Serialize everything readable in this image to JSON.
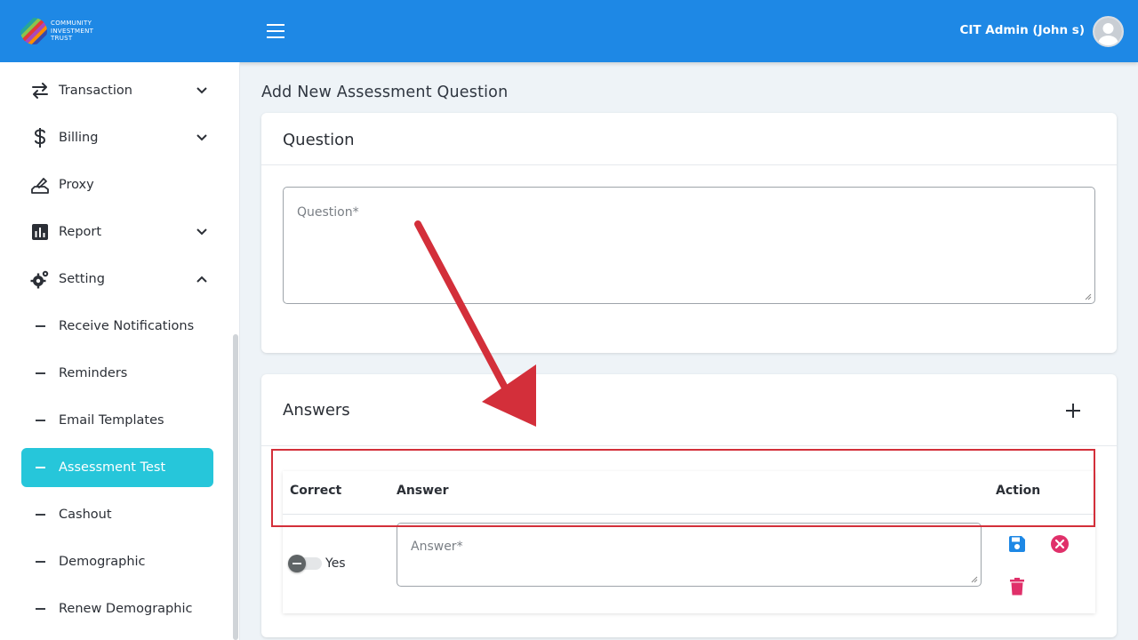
{
  "brand": {
    "logo_lines": [
      "COMMUNITY",
      "INVESTMENT",
      "TRUST"
    ]
  },
  "header": {
    "user_name": "CIT Admin (John s)"
  },
  "sidebar": {
    "items": [
      {
        "label": "Transaction",
        "icon": "transfer-arrows-icon",
        "chevron": "down"
      },
      {
        "label": "Billing",
        "icon": "dollar-icon",
        "chevron": "down"
      },
      {
        "label": "Proxy",
        "icon": "hand-pen-icon"
      },
      {
        "label": "Report",
        "icon": "bar-chart-icon",
        "chevron": "down"
      },
      {
        "label": "Setting",
        "icon": "gears-icon",
        "chevron": "up"
      }
    ],
    "sub_items": [
      {
        "label": "Receive Notifications"
      },
      {
        "label": "Reminders"
      },
      {
        "label": "Email Templates"
      },
      {
        "label": "Assessment Test",
        "active": true
      },
      {
        "label": "Cashout"
      },
      {
        "label": "Demographic"
      },
      {
        "label": "Renew Demographic"
      }
    ]
  },
  "main": {
    "page_title": "Add New Assessment Question",
    "question_card": {
      "title": "Question",
      "placeholder": "Question*",
      "value": ""
    },
    "answers_card": {
      "title": "Answers",
      "columns": {
        "correct": "Correct",
        "answer": "Answer",
        "action": "Action"
      },
      "rows": [
        {
          "correct_label": "Yes",
          "correct_on": false,
          "answer_placeholder": "Answer*",
          "answer_value": ""
        }
      ]
    }
  },
  "colors": {
    "header_bg": "#1e88e5",
    "active_item_bg": "#26c6da",
    "save_icon": "#1e88e5",
    "cancel_icon": "#e0306a",
    "delete_icon": "#e0306a",
    "annotation": "#d32f3a"
  }
}
